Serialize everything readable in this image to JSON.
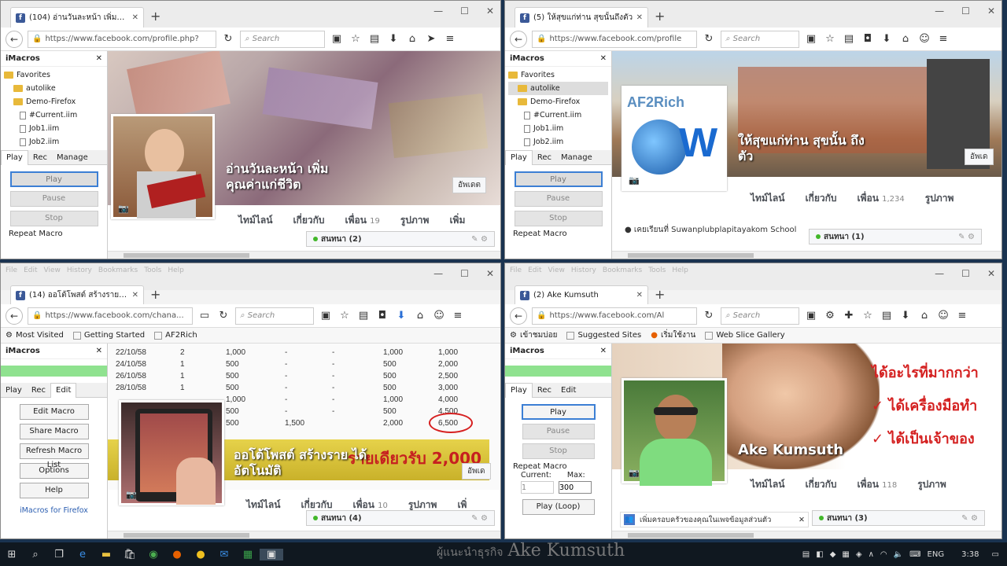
{
  "windows": [
    {
      "tab_title": "(104) อ่านวันละหน้า เพิ่มคุณ...",
      "url": "https://www.facebook.com/profile.php?",
      "search_placeholder": "Search",
      "imacros_title": "iMacros",
      "tree": [
        "Favorites",
        "autolike",
        "Demo-Firefox",
        "#Current.iim",
        "Job1.iim",
        "Job2.iim"
      ],
      "tabs": [
        "Play",
        "Rec",
        "Manage"
      ],
      "buttons": [
        "Play",
        "Pause",
        "Stop"
      ],
      "repeat": "Repeat Macro",
      "cover_title": "อ่านวันละหน้า เพิ่ม คุณค่าแก่ชีวิต",
      "update_btn": "อัพเดต",
      "nav": [
        {
          "label": "ไทม์ไลน์",
          "count": ""
        },
        {
          "label": "เกี่ยวกับ",
          "count": ""
        },
        {
          "label": "เพื่อน",
          "count": "19"
        },
        {
          "label": "รูปภาพ",
          "count": ""
        },
        {
          "label": "เพิ่ม",
          "count": ""
        }
      ],
      "chat": "สนทนา (2)"
    },
    {
      "tab_title": "(5) ให้สุขแก่ท่าน สุขนั้นถึงตัว",
      "url": "https://www.facebook.com/profile",
      "search_placeholder": "Search",
      "imacros_title": "iMacros",
      "tree": [
        "Favorites",
        "autolike",
        "Demo-Firefox",
        "#Current.iim",
        "Job1.iim",
        "Job2.iim"
      ],
      "tabs": [
        "Play",
        "Rec",
        "Manage"
      ],
      "buttons": [
        "Play",
        "Pause",
        "Stop"
      ],
      "repeat": "Repeat Macro",
      "logo_text": "AF2Rich",
      "cover_title": "ให้สุขแก่ท่าน สุขนั้น ถึงตัว",
      "update_btn": "อัพเด",
      "nav": [
        {
          "label": "ไทม์ไลน์",
          "count": ""
        },
        {
          "label": "เกี่ยวกับ",
          "count": ""
        },
        {
          "label": "เพื่อน",
          "count": "1,234"
        },
        {
          "label": "รูปภาพ",
          "count": ""
        }
      ],
      "school": "เคยเรียนที่ Suwanplubplapitayakom School",
      "chat": "สนทนา (1)"
    },
    {
      "menu": [
        "File",
        "Edit",
        "View",
        "History",
        "Bookmarks",
        "Tools",
        "Help"
      ],
      "tab_title": "(14) ออโต้โพสต์ สร้างรายได้...",
      "url": "https://www.facebook.com/chana...",
      "search_placeholder": "Search",
      "bookmarks": [
        "Most Visited",
        "Getting Started",
        "AF2Rich"
      ],
      "imacros_title": "iMacros",
      "tabs": [
        "Play",
        "Rec",
        "Edit"
      ],
      "buttons": [
        "Edit Macro",
        "Share Macro",
        "Refresh Macro List",
        "Options",
        "Help"
      ],
      "link": "iMacros for Firefox",
      "table_rows": [
        [
          "22/10/58",
          "2",
          "1,000",
          "-",
          "-",
          "1,000",
          "1,000"
        ],
        [
          "24/10/58",
          "1",
          "500",
          "-",
          "-",
          "500",
          "2,000"
        ],
        [
          "26/10/58",
          "1",
          "500",
          "-",
          "-",
          "500",
          "2,500"
        ],
        [
          "28/10/58",
          "1",
          "500",
          "-",
          "-",
          "500",
          "3,000"
        ],
        [
          "",
          "",
          "1,000",
          "-",
          "-",
          "1,000",
          "4,000"
        ],
        [
          "",
          "",
          "500",
          "-",
          "-",
          "500",
          "4,500"
        ],
        [
          "",
          "",
          "500",
          "1,500",
          "",
          "2,000",
          "6,500"
        ]
      ],
      "banner_text": "รายเดียวรับ 2,000",
      "cover_title": "ออโต้โพสต์ สร้างราย ได้อัตโนมัติ",
      "update_btn": "อัพเด",
      "nav": [
        {
          "label": "ไทม์ไลน์",
          "count": ""
        },
        {
          "label": "เกี่ยวกับ",
          "count": ""
        },
        {
          "label": "เพื่อน",
          "count": "10"
        },
        {
          "label": "รูปภาพ",
          "count": ""
        },
        {
          "label": "เพิ่",
          "count": ""
        }
      ],
      "chat": "สนทนา (4)"
    },
    {
      "menu": [
        "File",
        "Edit",
        "View",
        "History",
        "Bookmarks",
        "Tools",
        "Help"
      ],
      "tab_title": "(2) Ake Kumsuth",
      "url": "https://www.facebook.com/Al",
      "search_placeholder": "Search",
      "bookmarks": [
        "เข้าชมบ่อย",
        "Suggested Sites",
        "เริ่มใช้งาน",
        "Web Slice Gallery"
      ],
      "imacros_title": "iMacros",
      "tabs": [
        "Play",
        "Rec",
        "Edit"
      ],
      "buttons": [
        "Play",
        "Pause",
        "Stop"
      ],
      "repeat": "Repeat Macro",
      "current_label": "Current:",
      "max_label": "Max:",
      "current_value": "1",
      "max_value": "300",
      "loop_btn": "Play (Loop)",
      "cover_title": "Ake Kumsuth",
      "cover_lines": [
        "ได้อะไรที่มากกว่า",
        "ได้เครื่องมือทำ",
        "ได้เป็นเจ้าของ"
      ],
      "nav": [
        {
          "label": "ไทม์ไลน์",
          "count": ""
        },
        {
          "label": "เกี่ยวกับ",
          "count": ""
        },
        {
          "label": "เพื่อน",
          "count": "118"
        },
        {
          "label": "รูปภาพ",
          "count": ""
        }
      ],
      "notice": "เพิ่มครอบครัวของคุณในเพจข้อมูลส่วนตัว",
      "chat": "สนทนา (3)"
    }
  ],
  "taskbar": {
    "tray_lang": "ENG",
    "clock": "3:38"
  },
  "watermark": {
    "prefix": "ผู้แนะนำธุรกิจ",
    "name": "Ake Kumsuth"
  }
}
